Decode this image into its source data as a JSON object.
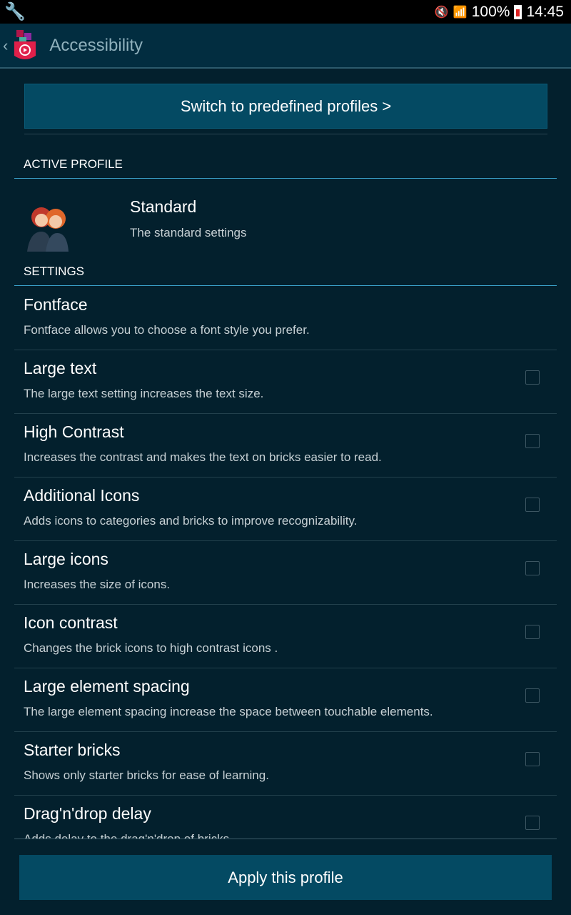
{
  "status_bar": {
    "battery": "100%",
    "time": "14:45"
  },
  "app_bar": {
    "title": "Accessibility"
  },
  "predefined_button": "Switch to predefined profiles >",
  "active_profile": {
    "header": "ACTIVE PROFILE",
    "name": "Standard",
    "description": "The standard settings"
  },
  "settings": {
    "header": "SETTINGS",
    "items": [
      {
        "title": "Fontface",
        "description": "Fontface allows you to choose a font style you prefer.",
        "checkbox": false
      },
      {
        "title": "Large text",
        "description": "The large text setting increases the text size.",
        "checkbox": true,
        "checked": false
      },
      {
        "title": "High Contrast",
        "description": "Increases the contrast and makes the text on bricks easier to read.",
        "checkbox": true,
        "checked": false
      },
      {
        "title": "Additional Icons",
        "description": "Adds icons to categories and bricks to improve recognizability.",
        "checkbox": true,
        "checked": false
      },
      {
        "title": "Large icons",
        "description": "Increases the size of icons.",
        "checkbox": true,
        "checked": false
      },
      {
        "title": "Icon contrast",
        "description": "Changes the brick icons to high contrast icons .",
        "checkbox": true,
        "checked": false
      },
      {
        "title": "Large element spacing",
        "description": "The large element spacing increase the space between touchable elements.",
        "checkbox": true,
        "checked": false
      },
      {
        "title": "Starter bricks",
        "description": "Shows only starter bricks for ease of learning.",
        "checkbox": true,
        "checked": false
      },
      {
        "title": "Drag'n'drop delay",
        "description": "Adds delay to the drag'n'drop of bricks.",
        "checkbox": true,
        "checked": false
      }
    ]
  },
  "apply_button": "Apply this profile"
}
